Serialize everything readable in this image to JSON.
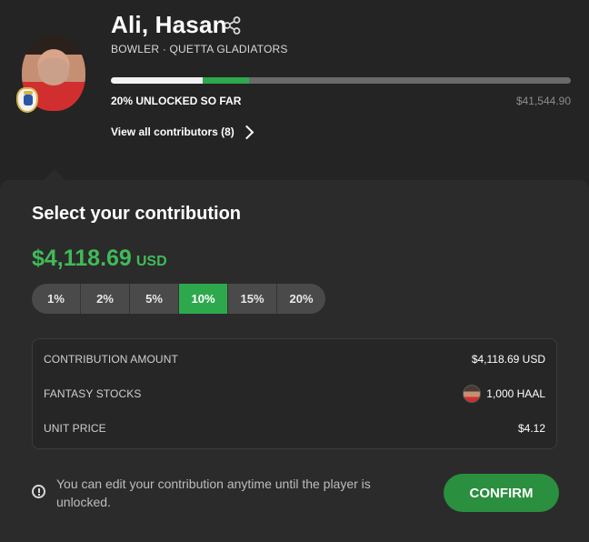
{
  "player": {
    "name": "Ali, Hasan",
    "role_team": "BOWLER · QUETTA GLADIATORS",
    "unlocked_text": "20% UNLOCKED SO FAR",
    "total_amount": "$41,544.90",
    "progress": {
      "white_fraction": 0.2,
      "green_fraction": 0.1
    },
    "contributors_link": "View all contributors (8)"
  },
  "card": {
    "title": "Select your contribution",
    "amount": "$4,118.69",
    "currency": "USD",
    "percentages": [
      "1%",
      "2%",
      "5%",
      "10%",
      "15%",
      "20%"
    ],
    "selected_percentage": "10%",
    "rows": [
      {
        "key": "CONTRIBUTION AMOUNT",
        "value": "$4,118.69 USD"
      },
      {
        "key": "FANTASY STOCKS",
        "value": "1,000 HAAL",
        "icon": "player-avatar-icon"
      },
      {
        "key": "UNIT PRICE",
        "value": "$4.12"
      }
    ],
    "note": "You can edit your contribution anytime until the player is unlocked.",
    "confirm_label": "CONFIRM"
  },
  "colors": {
    "accent_green": "#2ea84d",
    "amount_green": "#3fbb58",
    "background": "#242424",
    "card": "#2b2b2b"
  }
}
